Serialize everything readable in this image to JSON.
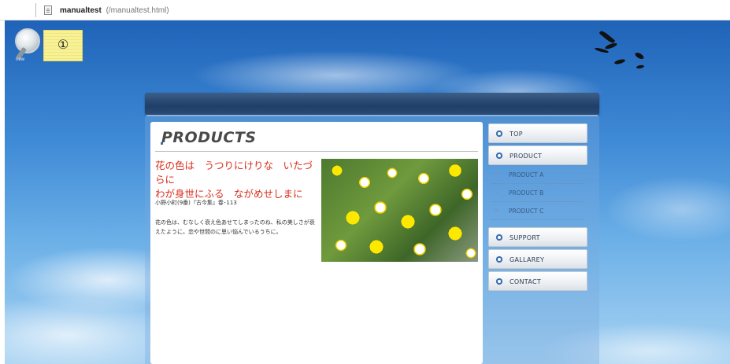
{
  "window": {
    "title": "manualtest",
    "path": "(/manualtest.html)"
  },
  "overlay": {
    "magnifier_label": "new",
    "note_text": "①"
  },
  "main": {
    "heading": "PRODUCTS",
    "poem_line1": "花の色は　うつりにけりな　いたづらに",
    "poem_line2": "わが身世にふる　ながめせしまに",
    "author": "小野小町(9番)『古今集』春･113",
    "description": "花の色は、むなしく衰え色あせてしまったのね、私の美しさが衰えたように。恋や世間のに思い悩んでいるうちに。"
  },
  "nav": {
    "items": [
      {
        "label": "TOP"
      },
      {
        "label": "PRODUCT"
      },
      {
        "label": "SUPPORT"
      },
      {
        "label": "GALLAREY"
      },
      {
        "label": "CONTACT"
      }
    ],
    "subitems": [
      {
        "label": "PRODUCT A"
      },
      {
        "label": "PRODUCT B"
      },
      {
        "label": "PRODUCT C"
      }
    ]
  },
  "colors": {
    "accent_red": "#d92d1b",
    "banner_navy": "#1f3f68",
    "nav_bullet": "#3b6fb0"
  },
  "icons": [
    "document-icon",
    "magnifier-icon",
    "bullet-icon",
    "arrow-icon"
  ]
}
